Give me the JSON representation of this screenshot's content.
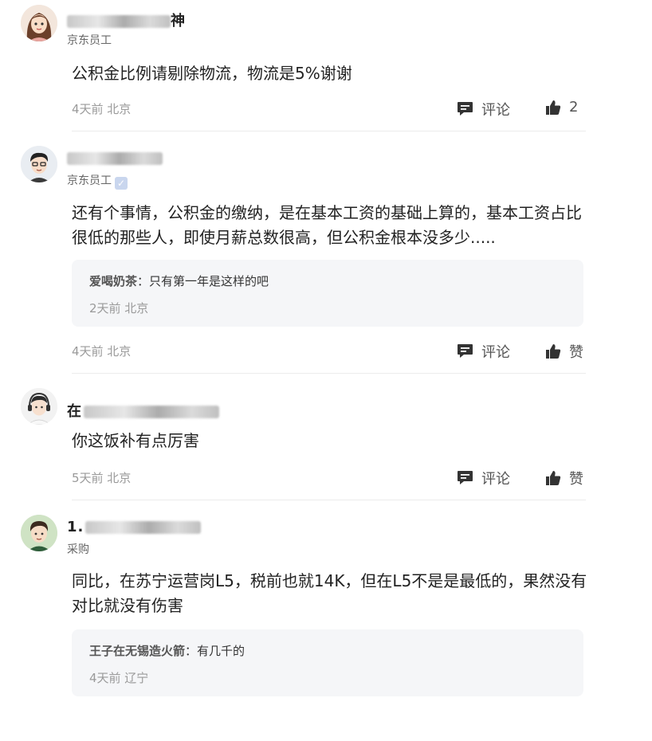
{
  "comments": [
    {
      "name_visible": "神",
      "role": "京东员工",
      "verified": false,
      "text": "公积金比例请剔除物流，物流是5%谢谢",
      "meta": "4天前 北京",
      "comment_label": "评论",
      "like_label": "2",
      "reply": null
    },
    {
      "name_visible": "",
      "role": "京东员工",
      "verified": true,
      "text": "还有个事情，公积金的缴纳，是在基本工资的基础上算的，基本工资占比很低的那些人，即使月薪总数很高，但公积金根本没多少.....",
      "meta": "4天前 北京",
      "comment_label": "评论",
      "like_label": "赞",
      "reply": {
        "author": "爱喝奶茶",
        "content": "只有第一年是这样的吧",
        "meta": "2天前 北京"
      }
    },
    {
      "name_visible": "在",
      "role": "",
      "verified": false,
      "text": "你这饭补有点厉害",
      "meta": "5天前 北京",
      "comment_label": "评论",
      "like_label": "赞",
      "reply": null
    },
    {
      "name_visible": "1.",
      "role": "采购",
      "verified": false,
      "text": "同比，在苏宁运营岗L5，税前也就14K，但在L5不是是最低的，果然没有对比就没有伤害",
      "meta": "",
      "comment_label": "",
      "like_label": "",
      "reply": {
        "author": "王子在无锡造火箭",
        "content": "有几千的",
        "meta": "4天前 辽宁"
      }
    }
  ]
}
